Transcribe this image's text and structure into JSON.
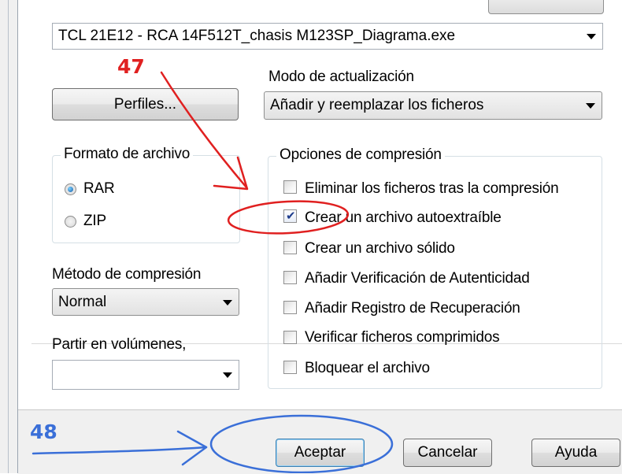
{
  "file_combo": {
    "value": "TCL 21E12 - RCA 14F512T_chasis M123SP_Diagrama.exe"
  },
  "profiles_button": {
    "label": "Perfiles..."
  },
  "update_mode": {
    "label": "Modo de actualización",
    "value": "Añadir y reemplazar los ficheros"
  },
  "archive_format": {
    "label": "Formato de archivo",
    "options": [
      {
        "label": "RAR",
        "selected": true
      },
      {
        "label": "ZIP",
        "selected": false
      }
    ]
  },
  "compression_method": {
    "label": "Método de compresión",
    "value": "Normal"
  },
  "split_volumes": {
    "label": "Partir en volúmenes,",
    "value": ""
  },
  "compression_options": {
    "label": "Opciones de compresión",
    "items": [
      {
        "label": "Eliminar los ficheros tras la compresión",
        "checked": false
      },
      {
        "label": "Crear un archivo autoextraíble",
        "checked": true
      },
      {
        "label": "Crear un archivo sólido",
        "checked": false
      },
      {
        "label": "Añadir Verificación de Autenticidad",
        "checked": false
      },
      {
        "label": "Añadir Registro de Recuperación",
        "checked": false
      },
      {
        "label": "Verificar ficheros comprimidos",
        "checked": false
      },
      {
        "label": "Bloquear el archivo",
        "checked": false
      }
    ]
  },
  "buttons": {
    "accept": "Aceptar",
    "cancel": "Cancelar",
    "help": "Ayuda"
  },
  "annotations": {
    "step_47": {
      "label": "47",
      "color": "#e02020"
    },
    "step_48": {
      "label": "48",
      "color": "#3a6fd8"
    }
  }
}
